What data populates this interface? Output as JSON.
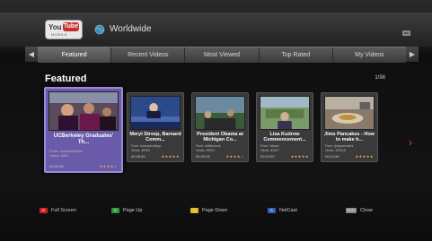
{
  "header": {
    "logo": {
      "you": "You",
      "tube": "Tube",
      "sub": "MOBILE"
    },
    "region": "Worldwide"
  },
  "tabs": [
    {
      "label": "Featured",
      "active": true
    },
    {
      "label": "Recent Videos",
      "active": false
    },
    {
      "label": "Most Viewed",
      "active": false
    },
    {
      "label": "Top Rated",
      "active": false
    },
    {
      "label": "My Videos",
      "active": false
    }
  ],
  "section": {
    "title": "Featured",
    "page": "1/98"
  },
  "videos": [
    {
      "title": "UCBerkeley Graduates' Th...",
      "from": "From: ucberkeleyfilm",
      "views": "Views: 3501",
      "duration": "02:04:00",
      "rating": "★★★★☆"
    },
    {
      "title": "Meryl Streep, Barnard Comm...",
      "from": "From: barnardcollege",
      "views": "Views: 46303",
      "duration": "00:26:59",
      "rating": "★★★★★"
    },
    {
      "title": "President Obama at Michigan Co...",
      "from": "From: whitehouse",
      "views": "Views: 29021",
      "duration": "00:33:28",
      "rating": "★★★★☆"
    },
    {
      "title": "Lisa Kudrow Commencement...",
      "from": "From: Vassar",
      "views": "Views: 53327",
      "duration": "00:23:50",
      "rating": "★★★★★"
    },
    {
      "title": "Jims Pancakes - How to make h...",
      "from": "From: jimspancakes",
      "views": "Views: 309316",
      "duration": "00:14:58",
      "rating": "★★★★★"
    }
  ],
  "footer": [
    {
      "color": "#d02020",
      "key": "R",
      "label": "Full Screen"
    },
    {
      "color": "#2a9a3a",
      "key": "G",
      "label": "Page Up"
    },
    {
      "color": "#d8c020",
      "key": "Y",
      "label": "Page Down"
    },
    {
      "color": "#3060c0",
      "key": "B",
      "label": "NetCast"
    },
    {
      "color": "#888888",
      "key": "EXIT",
      "label": "Close"
    }
  ]
}
